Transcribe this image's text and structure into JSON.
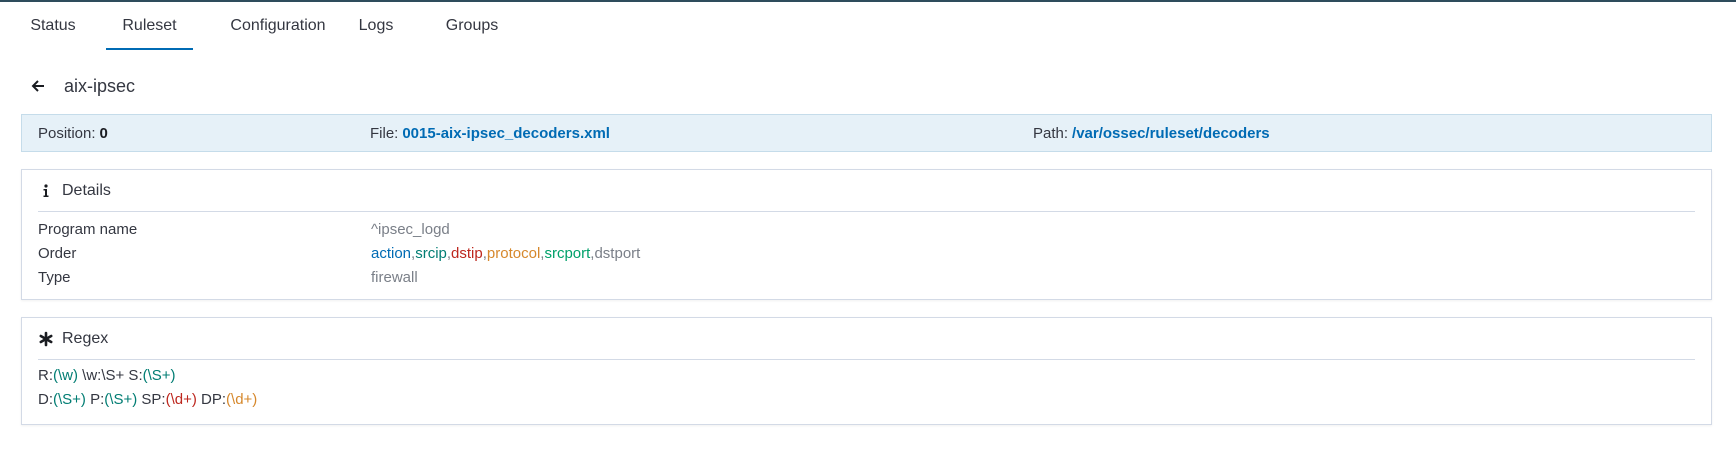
{
  "tabs": [
    {
      "label": "Status",
      "active": false
    },
    {
      "label": "Ruleset",
      "active": true
    },
    {
      "label": "Configuration",
      "active": false
    },
    {
      "label": "Logs",
      "active": false
    },
    {
      "label": "Groups",
      "active": false
    }
  ],
  "header": {
    "title": "aix-ipsec"
  },
  "info": {
    "position_label": "Position:",
    "position_value": "0",
    "file_label": "File:",
    "file_value": "0015-aix-ipsec_decoders.xml",
    "path_label": "Path:",
    "path_value": "/var/ossec/ruleset/decoders"
  },
  "details": {
    "heading": "Details",
    "program_name_label": "Program name",
    "program_name_value": "^ipsec_logd",
    "order_label": "Order",
    "order_values": [
      "action",
      ",",
      "srcip",
      ",",
      "dstip",
      ",",
      "protocol",
      ",",
      "srcport",
      ",",
      "dstport"
    ],
    "type_label": "Type",
    "type_value": "firewall"
  },
  "regex": {
    "heading": "Regex",
    "line1": [
      "R:",
      "(\\w)",
      " \\w:\\S+ S:",
      "(\\S+)"
    ],
    "line2": [
      "D:",
      "(\\S+)",
      " P:",
      "(\\S+)",
      " SP:",
      "(\\d+)",
      " DP:",
      "(\\d+)"
    ]
  },
  "colors": {
    "accent": "#006bb4",
    "info_bar_bg": "#e6f1f8",
    "order_action": "#006bb4",
    "order_srcip": "#017d73",
    "order_dstip": "#bd271e",
    "order_protocol": "#d6882c",
    "order_srcport": "#00a06a",
    "order_dstport": "#7a7f88"
  },
  "icons": {
    "back": "arrow-left-icon",
    "details": "info-icon",
    "regex": "asterisk-icon"
  }
}
